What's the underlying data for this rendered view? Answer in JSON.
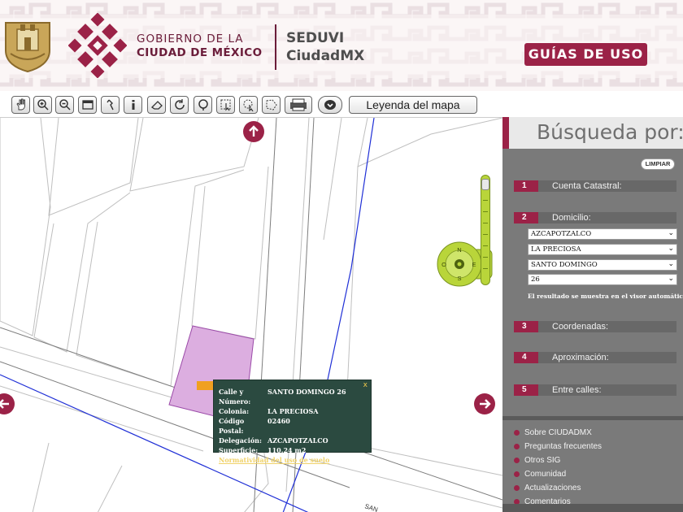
{
  "header": {
    "gob_line1": "GOBIERNO DE LA",
    "gob_line2": "CIUDAD DE MÉXICO",
    "seduvi_line1": "SEDUVI",
    "seduvi_line2": "CiudadMX",
    "guias_label": "GUÍAS DE USO",
    "brand_color": "#9b2247"
  },
  "toolbar": {
    "tools": [
      "pan-tool",
      "zoom-in-tool",
      "zoom-out-tool",
      "full-extent-tool",
      "measure-tool",
      "identify-tool",
      "eraser-tool",
      "refresh-tool",
      "search-tool",
      "select-tool",
      "lasso-select-tool",
      "polygon-select-tool",
      "print-tool",
      "visibility-tool"
    ],
    "legend_label": "Leyenda del mapa"
  },
  "map": {
    "street_label": "SAN",
    "parcel_color": "#dcaee0",
    "popup": {
      "rows": [
        {
          "key": "Calle y Número:",
          "value": "SANTO DOMINGO 26"
        },
        {
          "key": "Colonia:",
          "value": "LA PRECIOSA"
        },
        {
          "key": "Código Postal:",
          "value": "02460"
        },
        {
          "key": "Delegación:",
          "value": "AZCAPOTZALCO"
        },
        {
          "key": "Superficie:",
          "value": "110.24 m2"
        }
      ],
      "link": "Normatividad del uso de suelo",
      "close": "x"
    },
    "compass_letters": {
      "n": "N",
      "s": "S",
      "e": "E",
      "o": "O",
      "plus": "+",
      "minus": "−"
    }
  },
  "panel": {
    "title": "Búsqueda por:",
    "limpiar": "LIMPIAR",
    "sections": [
      {
        "num": "1",
        "label": "Cuenta Catastral:"
      },
      {
        "num": "2",
        "label": "Domicilio:"
      },
      {
        "num": "3",
        "label": "Coordenadas:"
      },
      {
        "num": "4",
        "label": "Aproximación:"
      },
      {
        "num": "5",
        "label": "Entre calles:"
      }
    ],
    "domicilio": {
      "delegacion": "AZCAPOTZALCO",
      "colonia": "LA PRECIOSA",
      "calle": "SANTO DOMINGO",
      "numero": "26"
    },
    "result_note": "El resultado se muestra en el visor automáticamente.",
    "links": [
      "Sobre CIUDADMX",
      "Preguntas frecuentes",
      "Otros SIG",
      "Comunidad",
      "Actualizaciones",
      "Comentarios"
    ]
  }
}
